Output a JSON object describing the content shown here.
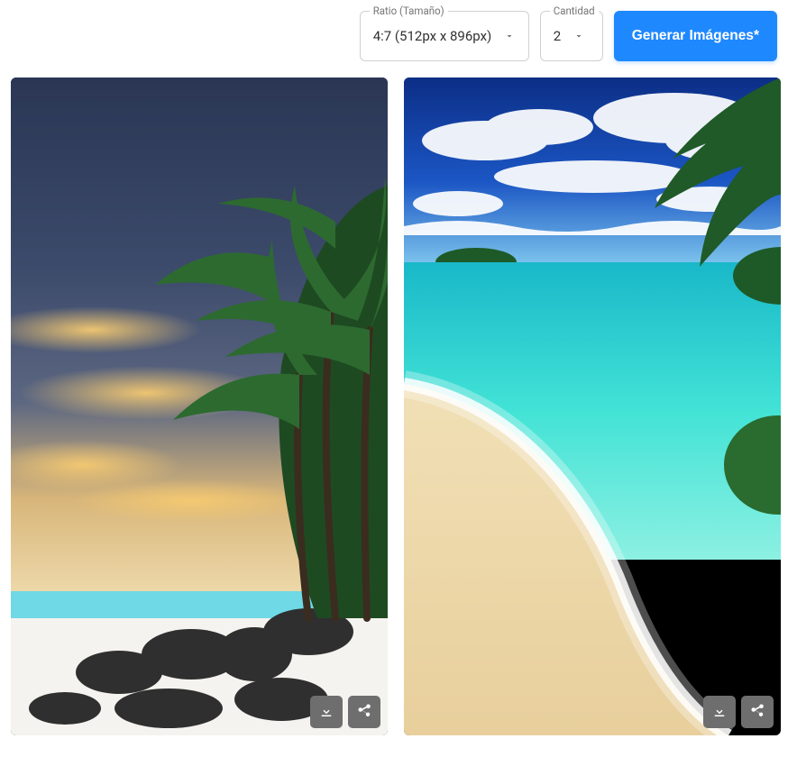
{
  "toolbar": {
    "ratio": {
      "label": "Ratio (Tamaño)",
      "value": "4:7 (512px x 896px)"
    },
    "qty": {
      "label": "Cantidad",
      "value": "2"
    },
    "generate_label": "Generar Imágenes*"
  },
  "images": [
    {
      "alt": "tropical-beach-sunset-palms"
    },
    {
      "alt": "turquoise-beach-aerial"
    }
  ]
}
